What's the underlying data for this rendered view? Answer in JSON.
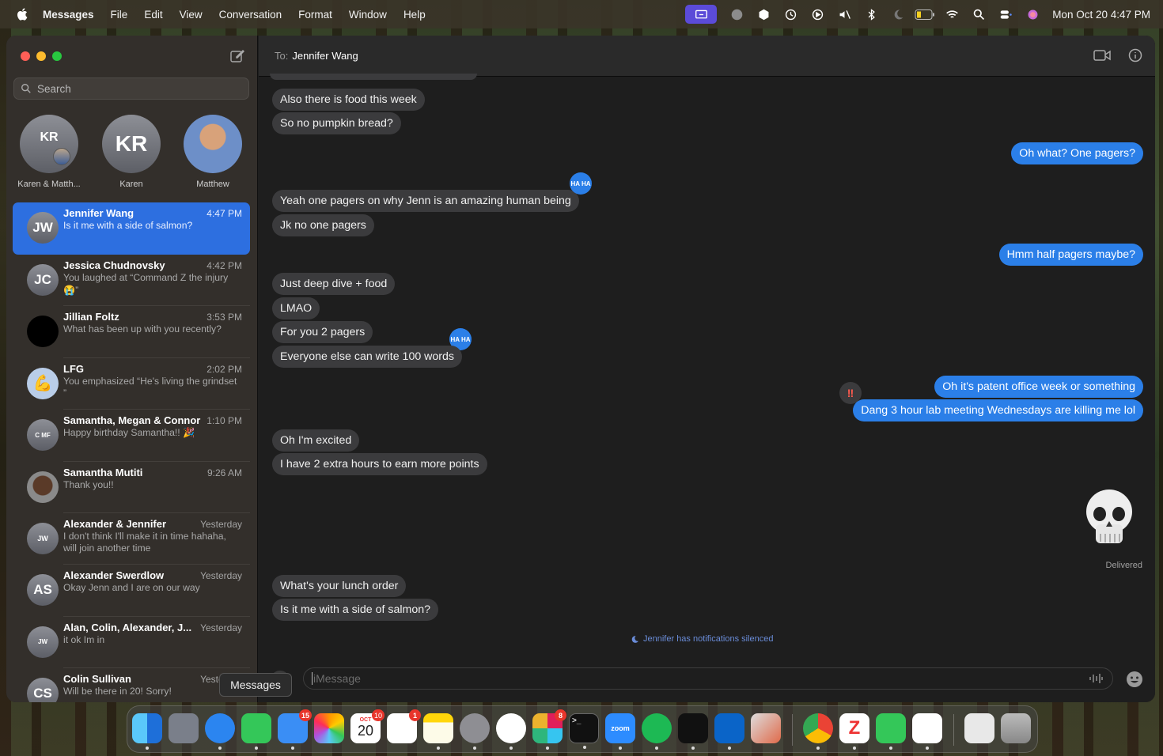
{
  "menubar": {
    "items": [
      "Messages",
      "File",
      "Edit",
      "View",
      "Conversation",
      "Format",
      "Window",
      "Help"
    ],
    "clock": "Mon Oct 20  4:47 PM"
  },
  "sidebar": {
    "search_placeholder": "Search",
    "pinned": [
      {
        "initials": "KR",
        "label": "Karen & Matth..."
      },
      {
        "initials": "KR",
        "label": "Karen"
      },
      {
        "initials": "",
        "label": "Matthew"
      }
    ],
    "conversations": [
      {
        "initials": "JW",
        "name": "Jennifer Wang",
        "time": "4:47 PM",
        "preview": "Is it me with a side of salmon?",
        "selected": true
      },
      {
        "initials": "JC",
        "name": "Jessica Chudnovsky",
        "time": "4:42 PM",
        "preview": "You laughed at “Command Z the injury 😭”"
      },
      {
        "initials": "",
        "name": "Jillian Foltz",
        "time": "3:53 PM",
        "preview": "What has been up with you recently?"
      },
      {
        "initials": "💪",
        "name": "LFG",
        "time": "2:02 PM",
        "preview": "You emphasized “He's living the grindset ”"
      },
      {
        "initials": "C MF",
        "name": "Samantha, Megan & Connor",
        "time": "1:10 PM",
        "preview": "Happy birthday Samantha!! 🎉"
      },
      {
        "initials": "",
        "name": "Samantha Mutiti",
        "time": "9:26 AM",
        "preview": "Thank you!!"
      },
      {
        "initials": "JW",
        "name": "Alexander & Jennifer",
        "time": "Yesterday",
        "preview": "I don't think I'll make it in time hahaha, will join another time"
      },
      {
        "initials": "AS",
        "name": "Alexander Swerdlow",
        "time": "Yesterday",
        "preview": "Okay Jenn and I are on our way"
      },
      {
        "initials": "JW",
        "name": "Alan, Colin, Alexander, J...",
        "time": "Yesterday",
        "preview": "it ok Im in"
      },
      {
        "initials": "CS",
        "name": "Colin Sullivan",
        "time": "Yesterday",
        "preview": "Will be there in 20! Sorry!"
      }
    ]
  },
  "conversation": {
    "to_label": "To:",
    "recipient": "Jennifer Wang",
    "messages": [
      {
        "dir": "in",
        "text": "Also there is food this week"
      },
      {
        "dir": "in",
        "text": "So no pumpkin bread?"
      },
      {
        "dir": "out",
        "text": "Oh what?  One pagers?"
      },
      {
        "dir": "in",
        "text": "Yeah one pagers on why Jenn is an amazing human being"
      },
      {
        "dir": "in",
        "text": "Jk no one pagers"
      },
      {
        "dir": "out",
        "text": "Hmm half pagers maybe?"
      },
      {
        "dir": "in",
        "text": "Just deep dive + food"
      },
      {
        "dir": "in",
        "text": "LMAO"
      },
      {
        "dir": "in",
        "text": "For you 2 pagers"
      },
      {
        "dir": "in",
        "text": "Everyone else can write 100 words"
      },
      {
        "dir": "out",
        "text": "Oh it's patent office week or something"
      },
      {
        "dir": "out",
        "text": "Dang 3 hour lab meeting Wednesdays are killing me lol"
      },
      {
        "dir": "in",
        "text": "Oh I'm excited"
      },
      {
        "dir": "in",
        "text": " I have 2 extra hours to earn more points"
      },
      {
        "dir": "in",
        "text": "What's your lunch order"
      },
      {
        "dir": "in",
        "text": "Is it me with a side of salmon?"
      }
    ],
    "tapback_haha": "HA HA",
    "tapback_bang": "‼",
    "delivered": "Delivered",
    "silenced": "Jennifer has notifications silenced",
    "input_placeholder": "iMessage"
  },
  "tooltip": "Messages",
  "dock": {
    "badges": {
      "mail": "15",
      "calendar_day": "20",
      "calendar_month": "OCT",
      "calendar_badge": "10",
      "reminders": "1",
      "slack": "8"
    },
    "zoom_label": "zoom"
  }
}
